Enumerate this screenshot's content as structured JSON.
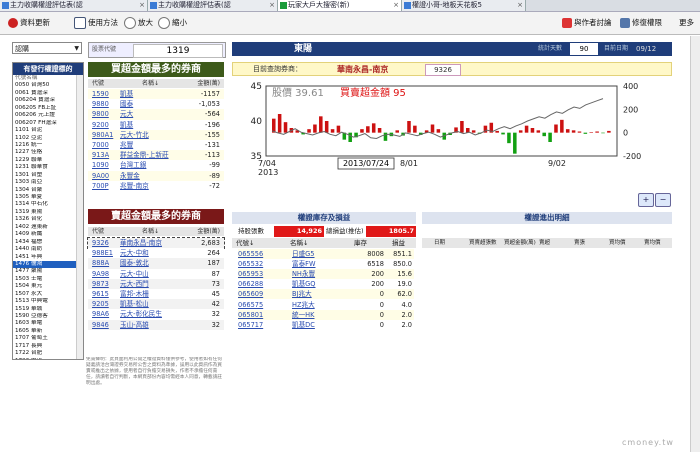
{
  "browser_tabs": [
    {
      "label": "主力收購權證評估表(認",
      "active": false
    },
    {
      "label": "主力收購權證評估表(認",
      "active": false
    },
    {
      "label": "玩家大戶大搜密(新)",
      "active": true
    },
    {
      "label": "權證小哥-地板天花板5",
      "active": false
    }
  ],
  "toolbar": {
    "refresh": "資料更新",
    "help": "使用方法",
    "zoom_in": "放大",
    "zoom_out": "縮小",
    "author": "與作者討論",
    "bugs": "修復權限",
    "more": "更多"
  },
  "left": {
    "select_value": "認購",
    "list_header": "有發行權證標的",
    "list_top": "代號名稱",
    "items": [
      "0050 台灣50",
      "0061 寶滬深",
      "006204 寶滬深",
      "006205 FB上証",
      "006206 元上證",
      "006207 FH滬深",
      "1101 台泥",
      "1102 亞泥",
      "1216 統一",
      "1227 佳格",
      "1229 聯華",
      "1231 聯華食",
      "1301 台塑",
      "1303 南亞",
      "1304 台聚",
      "1305 華夏",
      "1314 中石化",
      "1319 東陽",
      "1326 台化",
      "1402 遠東新",
      "1409 新纖",
      "1434 福懋",
      "1440 南紡",
      "1451 年興",
      "1476 儒鴻",
      "1477 聚陽",
      "1503 士電",
      "1504 東元",
      "1507 永大",
      "1513 中興電",
      "1519 華城",
      "1590 亞德客",
      "1603 華電",
      "1605 華新",
      "1707 葡萄王",
      "1717 長興",
      "1722 台肥",
      "1723 中碳",
      "1760 寶齡",
      "1789 神隆",
      "1795 美時",
      "1802 台玻"
    ],
    "selected_index": 24
  },
  "stock": {
    "code_label": "股票代號",
    "code": "1319",
    "name": "東陽",
    "days_label": "統計天數",
    "days": "90",
    "date_label": "目前日期",
    "date": "09/12"
  },
  "broker_bar": {
    "label": "目前查詢券商：",
    "broker": "華南永昌-南京",
    "code": "9326"
  },
  "buy_table": {
    "title": "買超金額最多的券商",
    "cols": [
      "代號",
      "名稱↓",
      "金額(萬)"
    ],
    "rows": [
      [
        "1590",
        "凱基",
        "-1157"
      ],
      [
        "9880",
        "國泰",
        "-1,053"
      ],
      [
        "9800",
        "元大",
        "-564"
      ],
      [
        "9200",
        "凱基",
        "-196"
      ],
      [
        "980A1",
        "元大-竹北",
        "-155"
      ],
      [
        "7000",
        "兆豐",
        "-131"
      ],
      [
        "913A",
        "群益金鼎-上新莊",
        "-113"
      ],
      [
        "1090",
        "台灣工銀",
        "-99"
      ],
      [
        "9A00",
        "永豐金",
        "-89"
      ],
      [
        "700P",
        "兆豐-南京",
        "-72"
      ]
    ]
  },
  "sell_table": {
    "title": "賣超金額最多的券商",
    "cols": [
      "代號",
      "名稱↓",
      "金額(萬)"
    ],
    "rows": [
      [
        "9326",
        "華南永昌-南京",
        "2,683"
      ],
      [
        "988E1",
        "元大-中和",
        "264"
      ],
      [
        "888A",
        "國泰-敦北",
        "187"
      ],
      [
        "9A98",
        "元大-中山",
        "87"
      ],
      [
        "9873",
        "元大-西門",
        "73"
      ],
      [
        "9615",
        "富邦-木柵",
        "45"
      ],
      [
        "9205",
        "凱基-松山",
        "42"
      ],
      [
        "98A6",
        "元大-彰化民生",
        "32"
      ],
      [
        "9846",
        "玉山-高雄",
        "32"
      ]
    ]
  },
  "chart_data": {
    "type": "bar",
    "title": "",
    "legend": [
      "股價 39.61",
      "買賣超金額 95"
    ],
    "xlabel": "",
    "x_ticks": [
      "7/04 2013",
      "8/01",
      "9/02"
    ],
    "hover_label": "2013/07/24",
    "ylabel_left": "",
    "ylabel_right": "",
    "ylim_left": [
      35,
      45
    ],
    "ylim_right": [
      -200,
      400
    ],
    "left_ticks": [
      "45",
      "40",
      "35"
    ],
    "right_ticks": [
      "400",
      "200",
      "0",
      "-200"
    ],
    "price_series": [
      38.6,
      38.3,
      38.1,
      38.5,
      38.9,
      38.4,
      38.2,
      38.0,
      38.3,
      38.5,
      38.1,
      37.9,
      38.4,
      38.1,
      37.7,
      37.9,
      38.2,
      37.6,
      37.5,
      37.9,
      38.1,
      38.0,
      37.8,
      38.3,
      38.1,
      37.9,
      38.2,
      38.4,
      38.1,
      37.7,
      38.0,
      38.3,
      38.5,
      38.2,
      38.4,
      38.0,
      38.3,
      38.7,
      38.5,
      38.9,
      39.2,
      38.9,
      39.3,
      39.6,
      40.0,
      40.3,
      40.6,
      40.4,
      40.9,
      41.3,
      41.1,
      41.6,
      42.0,
      41.8,
      42.3,
      42.6,
      42.9,
      43.2
    ],
    "flow_series": [
      120,
      160,
      90,
      40,
      20,
      -15,
      30,
      70,
      140,
      100,
      30,
      60,
      -60,
      -80,
      -40,
      30,
      55,
      80,
      40,
      -70,
      -30,
      20,
      -25,
      100,
      60,
      -20,
      20,
      70,
      30,
      -60,
      -20,
      45,
      100,
      40,
      20,
      -10,
      60,
      85,
      15,
      -15,
      -90,
      -180,
      20,
      60,
      40,
      20,
      -30,
      -80,
      70,
      110,
      30,
      20,
      10,
      -10,
      5,
      10,
      -5,
      15
    ],
    "price_color": "#666666",
    "up_color": "#cc1111",
    "down_color": "#12a012"
  },
  "permit": {
    "title": "權證庫存及損益",
    "hold_label": "持股張數",
    "hold_value": "14,926",
    "pnl_label": "總損益(推估)",
    "pnl_value": "1805.7",
    "cols": [
      "代號↓",
      "名稱↓",
      "庫存",
      "損益"
    ],
    "rows": [
      [
        "065556",
        "日盛G5",
        "8008",
        "851.1"
      ],
      [
        "065532",
        "富泰FW",
        "6518",
        "850.0"
      ],
      [
        "065953",
        "NH永豐",
        "200",
        "15.6"
      ],
      [
        "066288",
        "凱基GQ",
        "200",
        "19.0"
      ],
      [
        "065609",
        "BJ兆大",
        "0",
        "62.0"
      ],
      [
        "066575",
        "HZ兆大",
        "0",
        "4.0"
      ],
      [
        "065801",
        "統一HK",
        "0",
        "2.0"
      ],
      [
        "065717",
        "凱基DC",
        "0",
        "2.0"
      ]
    ]
  },
  "detail": {
    "title": "權證進出明細",
    "cols": [
      "日期",
      "買賣超張數",
      "買超金額(萬)",
      "賣超",
      "賣張",
      "買均價",
      "賣均價"
    ]
  },
  "disclaimer": "免責聲明：此頁面利用公開之權證資料僅供參考，使用者如有任何疑義請洽台灣證券交易所公告之資料為準據，誤用以此資訊作為買賣或推出之依據，使用者自行負擔交易損失，作者不承擔任何責任，請讀者自行判斷，本網頁部份內容均需經本人同意，轉載請註明出處。",
  "watermark": "cmoney.tw"
}
